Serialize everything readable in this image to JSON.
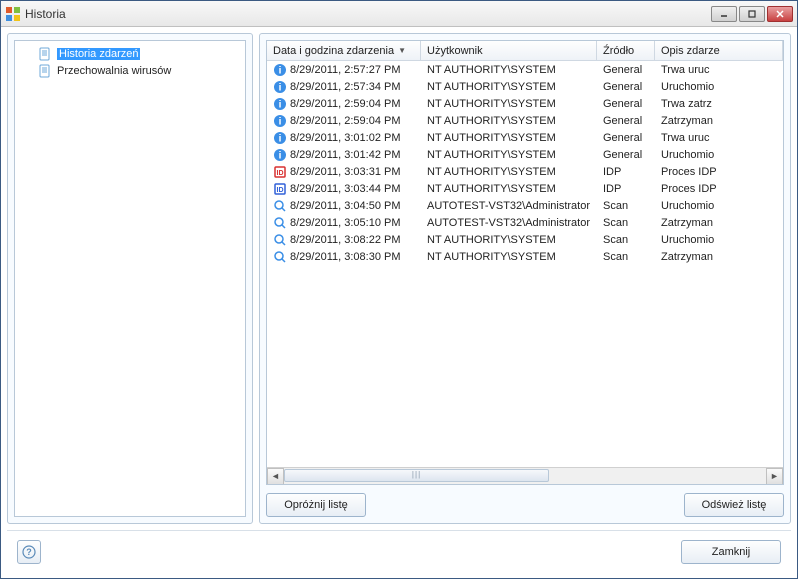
{
  "window": {
    "title": "Historia"
  },
  "tree": {
    "items": [
      {
        "label": "Historia zdarzeń",
        "selected": true
      },
      {
        "label": "Przechowalnia wirusów",
        "selected": false
      }
    ]
  },
  "columns": {
    "c0": "Data i godzina zdarzenia",
    "c1": "Użytkownik",
    "c2": "Źródło",
    "c3": "Opis zdarze"
  },
  "rows": [
    {
      "icon": "info",
      "date": "8/29/2011, 2:57:27 PM",
      "user": "NT AUTHORITY\\SYSTEM",
      "source": "General",
      "desc": "Trwa uruc"
    },
    {
      "icon": "info",
      "date": "8/29/2011, 2:57:34 PM",
      "user": "NT AUTHORITY\\SYSTEM",
      "source": "General",
      "desc": "Uruchomio"
    },
    {
      "icon": "info",
      "date": "8/29/2011, 2:59:04 PM",
      "user": "NT AUTHORITY\\SYSTEM",
      "source": "General",
      "desc": "Trwa zatrz"
    },
    {
      "icon": "info",
      "date": "8/29/2011, 2:59:04 PM",
      "user": "NT AUTHORITY\\SYSTEM",
      "source": "General",
      "desc": "Zatrzyman"
    },
    {
      "icon": "info",
      "date": "8/29/2011, 3:01:02 PM",
      "user": "NT AUTHORITY\\SYSTEM",
      "source": "General",
      "desc": "Trwa uruc"
    },
    {
      "icon": "info",
      "date": "8/29/2011, 3:01:42 PM",
      "user": "NT AUTHORITY\\SYSTEM",
      "source": "General",
      "desc": "Uruchomio"
    },
    {
      "icon": "idp-red",
      "date": "8/29/2011, 3:03:31 PM",
      "user": "NT AUTHORITY\\SYSTEM",
      "source": "IDP",
      "desc": "Proces IDP"
    },
    {
      "icon": "idp-blue",
      "date": "8/29/2011, 3:03:44 PM",
      "user": "NT AUTHORITY\\SYSTEM",
      "source": "IDP",
      "desc": "Proces IDP"
    },
    {
      "icon": "search",
      "date": "8/29/2011, 3:04:50 PM",
      "user": "AUTOTEST-VST32\\Administrator",
      "source": "Scan",
      "desc": "Uruchomio"
    },
    {
      "icon": "search",
      "date": "8/29/2011, 3:05:10 PM",
      "user": "AUTOTEST-VST32\\Administrator",
      "source": "Scan",
      "desc": "Zatrzyman"
    },
    {
      "icon": "search",
      "date": "8/29/2011, 3:08:22 PM",
      "user": "NT AUTHORITY\\SYSTEM",
      "source": "Scan",
      "desc": "Uruchomio"
    },
    {
      "icon": "search",
      "date": "8/29/2011, 3:08:30 PM",
      "user": "NT AUTHORITY\\SYSTEM",
      "source": "Scan",
      "desc": "Zatrzyman"
    }
  ],
  "buttons": {
    "empty": "Opróżnij listę",
    "refresh": "Odśwież listę",
    "close": "Zamknij"
  }
}
